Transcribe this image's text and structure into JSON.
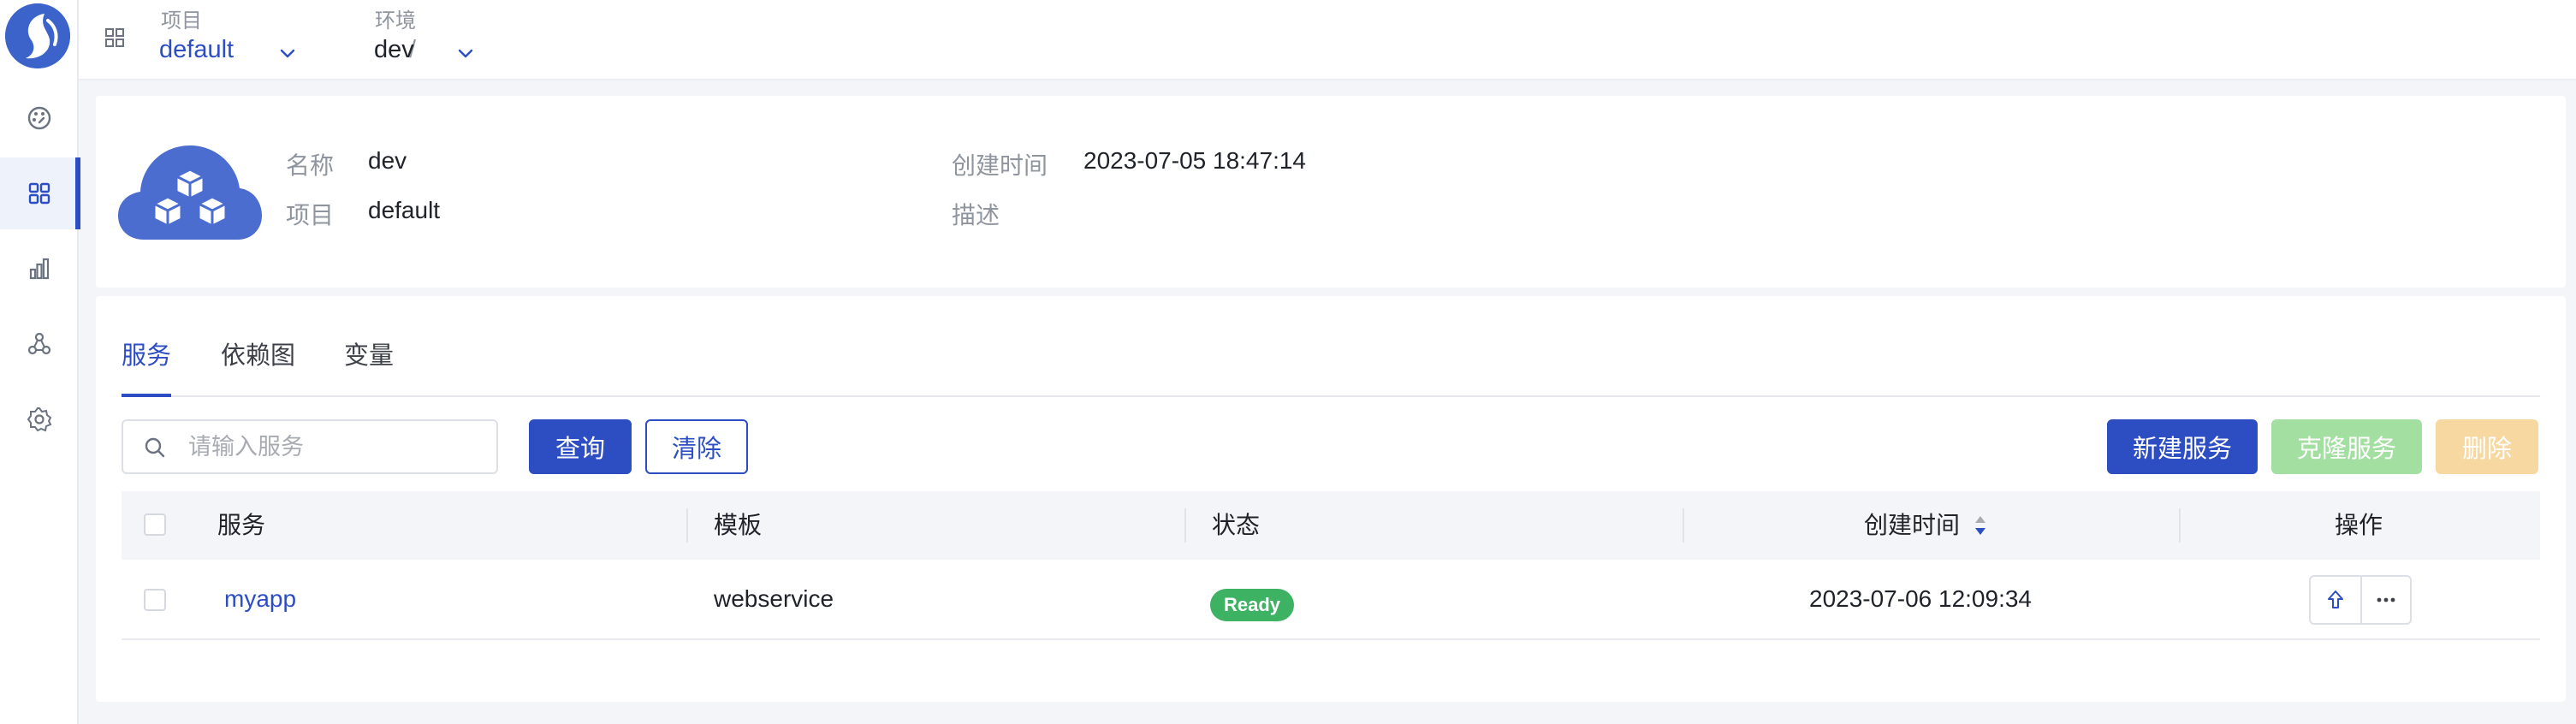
{
  "sidebar": {
    "logo": "app-logo",
    "items": [
      {
        "icon": "dashboard-icon",
        "active": false
      },
      {
        "icon": "apps-grid-icon",
        "active": true
      },
      {
        "icon": "bar-chart-icon",
        "active": false
      },
      {
        "icon": "cluster-icon",
        "active": false
      },
      {
        "icon": "gear-icon",
        "active": false
      }
    ]
  },
  "topbar": {
    "project_label": "项目",
    "project_value": "default",
    "separator": "/",
    "env_label": "环境",
    "env_value": "dev"
  },
  "info": {
    "name_label": "名称",
    "name_value": "dev",
    "project_label": "项目",
    "project_value": "default",
    "created_label": "创建时间",
    "created_value": "2023-07-05 18:47:14",
    "desc_label": "描述",
    "desc_value": ""
  },
  "tabs": [
    {
      "label": "服务",
      "active": true
    },
    {
      "label": "依赖图",
      "active": false
    },
    {
      "label": "变量",
      "active": false
    }
  ],
  "toolbar": {
    "search_placeholder": "请输入服务",
    "query_label": "查询",
    "clear_label": "清除",
    "new_label": "新建服务",
    "clone_label": "克隆服务",
    "delete_label": "删除"
  },
  "table": {
    "columns": [
      "服务",
      "模板",
      "状态",
      "创建时间",
      "操作"
    ],
    "rows": [
      {
        "service": "myapp",
        "template": "webservice",
        "status": "Ready",
        "created": "2023-07-06 12:09:34"
      }
    ]
  },
  "colors": {
    "primary": "#2d4dc3",
    "success": "#3db262",
    "clone_disabled": "#a3dfa0",
    "delete_disabled": "#f6d8a0"
  }
}
